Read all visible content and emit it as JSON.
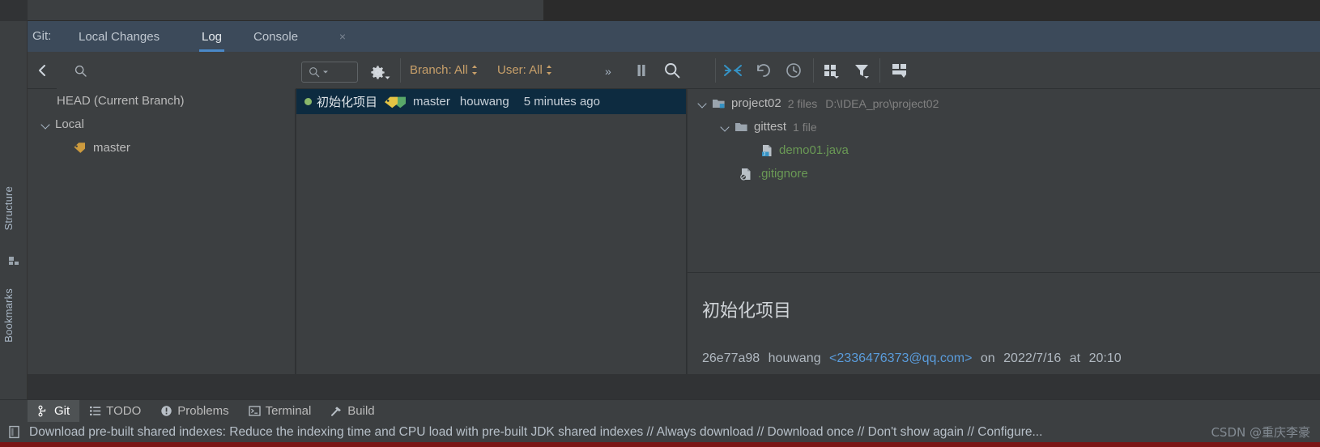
{
  "vertical_bar": {
    "labels": [
      {
        "name": "structure",
        "text": "Structure"
      },
      {
        "name": "bookmarks",
        "text": "Bookmarks"
      }
    ]
  },
  "tabbar": {
    "prefix": "Git:",
    "tabs": [
      {
        "label": "Local Changes",
        "active": false
      },
      {
        "label": "Log",
        "active": true
      },
      {
        "label": "Console",
        "active": false,
        "closable": true
      }
    ],
    "close_glyph": "×"
  },
  "toolbar": {
    "collapse_icon": "chevron-left-icon",
    "search_placeholder": "",
    "search_value": "",
    "gear_label": "settings",
    "branch_filter": "Branch: All",
    "user_filter": "User: All",
    "more_label": "»",
    "updown_glyph": "↕",
    "right_icons": [
      "collapse-arrows-icon",
      "revert-icon",
      "history-clock-icon",
      "show-details-grid-icon",
      "filter-icon",
      "layout-split-icon"
    ]
  },
  "branch_tree": [
    {
      "label": "HEAD (Current Branch)",
      "indent": 36,
      "chevron": false,
      "icon": "none"
    },
    {
      "label": "Local",
      "indent": 16,
      "chevron": true,
      "icon": "none"
    },
    {
      "label": "master",
      "indent": 56,
      "chevron": false,
      "icon": "branch-tag-icon"
    }
  ],
  "commits": [
    {
      "subject": "初始化项目",
      "refs": "master",
      "author": "houwang",
      "date": "5 minutes ago",
      "selected": true,
      "dot_color": "#8bb86a"
    }
  ],
  "changed_files": [
    {
      "name": "project02",
      "count": "2 files",
      "path": "D:\\IDEA_pro\\project02",
      "indent": 12,
      "chevron": true,
      "icon": "module-folder-icon",
      "green": false
    },
    {
      "name": "gittest",
      "count": "1 file",
      "path": "",
      "indent": 40,
      "chevron": true,
      "icon": "folder-icon",
      "green": false
    },
    {
      "name": "demo01.java",
      "count": "",
      "path": "",
      "indent": 90,
      "chevron": false,
      "icon": "java-file-icon",
      "green": true
    },
    {
      "name": ".gitignore",
      "count": "",
      "path": "",
      "indent": 64,
      "chevron": false,
      "icon": "ignored-file-icon",
      "green": true
    }
  ],
  "commit_details": {
    "message": "初始化项目",
    "hash": "26e77a98",
    "author": "houwang",
    "email": "<2336476373@qq.com>",
    "on_word": "on",
    "date": "2022/7/16",
    "at_word": "at",
    "time": "20:10"
  },
  "tool_window_bar": [
    {
      "label": "Git",
      "icon": "git-branch-icon",
      "selected": true
    },
    {
      "label": "TODO",
      "icon": "todo-list-icon",
      "selected": false
    },
    {
      "label": "Problems",
      "icon": "problems-warning-icon",
      "selected": false
    },
    {
      "label": "Terminal",
      "icon": "terminal-icon",
      "selected": false
    },
    {
      "label": "Build",
      "icon": "build-hammer-icon",
      "selected": false
    }
  ],
  "notification": {
    "icon": "ide-notification-icon",
    "text": "Download pre-built shared indexes: Reduce the indexing time and CPU load with pre-built JDK shared indexes // Always download // Download once // Don't show again // Configure..."
  },
  "watermark": {
    "text": "CSDN @重庆李豪"
  },
  "colors": {
    "tabbar_bg": "#3c4a5a",
    "panel_bg": "#3c3f41",
    "selection_bg": "#0d2b40",
    "accent_blue": "#4a88c7",
    "filter_text": "#c8a06a",
    "file_green": "#6a9955",
    "link_blue": "#5a9cdb",
    "commit_dot": "#8bb86a",
    "red_strip": "#7a1616"
  }
}
